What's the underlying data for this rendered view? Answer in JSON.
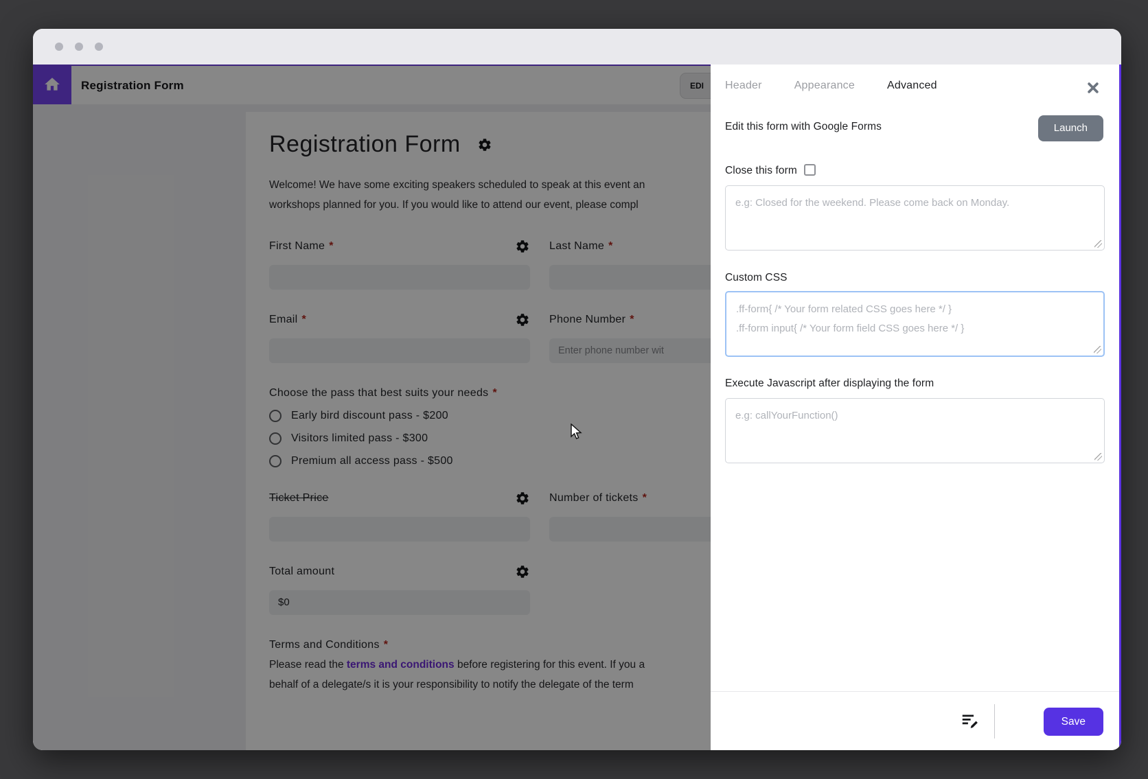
{
  "app_header": {
    "title": "Registration Form",
    "edit_button_label": "EDI"
  },
  "form": {
    "title": "Registration Form",
    "welcome_line1": "Welcome! We have some exciting speakers scheduled to speak at this event an",
    "welcome_line2": "workshops planned for you. If you would like to attend our event, please compl",
    "required_mark": "*",
    "first_name_label": "First Name",
    "last_name_label": "Last Name",
    "email_label": "Email",
    "phone_label": "Phone Number",
    "phone_placeholder": "Enter phone number wit",
    "pass_group_label": "Choose the pass that best suits your needs",
    "pass_options": [
      "Early bird discount pass - $200",
      "Visitors limited pass - $300",
      "Premium all access pass - $500"
    ],
    "ticket_price_label": "Ticket Price",
    "tickets_label": "Number of tickets",
    "total_label": "Total amount",
    "total_value": "$0",
    "terms_label": "Terms and Conditions",
    "terms_line1_pre": "Please read the ",
    "terms_link_text": "terms and conditions",
    "terms_line1_post": " before registering for this event. If you a",
    "terms_line2": "behalf of a delegate/s it is your responsibility to notify the delegate of the term"
  },
  "panel": {
    "tabs": [
      {
        "label": "Header",
        "active": false
      },
      {
        "label": "Appearance",
        "active": false
      },
      {
        "label": "Advanced",
        "active": true
      }
    ],
    "google_forms_label": "Edit this form with Google Forms",
    "launch_button": "Launch",
    "close_form_label": "Close this form",
    "close_form_checked": false,
    "close_form_placeholder": "e.g: Closed for the weekend. Please come back on Monday.",
    "custom_css_label": "Custom CSS",
    "custom_css_placeholder_line1": ".ff-form{ /* Your form related CSS goes here */ }",
    "custom_css_placeholder_line2": ".ff-form input{ /* Your form field CSS goes here */ }",
    "execute_js_label": "Execute Javascript after displaying the form",
    "execute_js_placeholder": "e.g: callYourFunction()",
    "save_button": "Save"
  },
  "colors": {
    "accent_purple": "#5632e3",
    "home_button_purple": "#7645f0",
    "launch_gray": "#6e7681",
    "focus_border_blue": "#9cc2f5",
    "terms_link_purple": "#6f2cda",
    "required_red": "#b3261e",
    "panel_edge_purple": "#5b33e0"
  }
}
